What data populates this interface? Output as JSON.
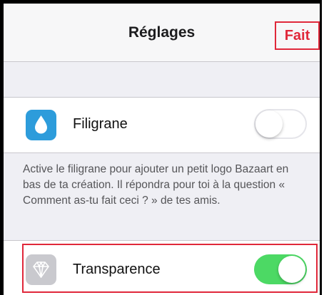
{
  "navbar": {
    "title": "Réglages",
    "done_label": "Fait"
  },
  "settings": {
    "filigrane": {
      "label": "Filigrane",
      "icon": "water-drop-icon",
      "enabled": false
    },
    "filigrane_footer": "Active le filigrane pour ajouter un petit logo Bazaart en bas de ta création. Il répondra pour toi à la question « Comment as-tu fait ceci ? » de tes amis.",
    "transparence": {
      "label": "Transparence",
      "icon": "diamond-icon",
      "enabled": true
    }
  },
  "colors": {
    "accent": "#e0283a",
    "toggle_on": "#4cd964",
    "filigrane_icon_bg": "#2d9cdb",
    "transparence_icon_bg": "#c9c9ce"
  }
}
